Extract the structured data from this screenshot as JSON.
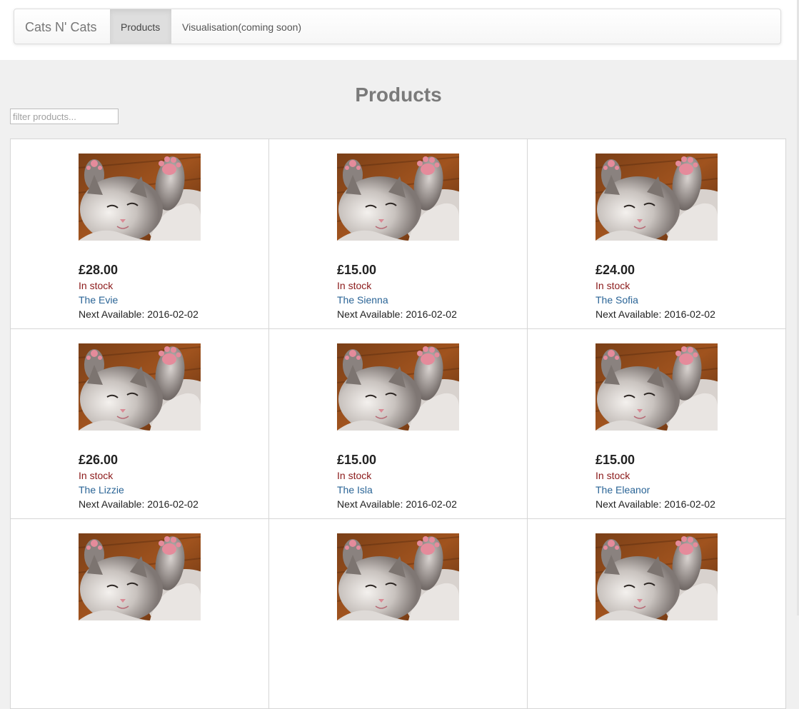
{
  "nav": {
    "brand": "Cats N' Cats",
    "items": [
      {
        "label": "Products",
        "active": true
      },
      {
        "label": "Visualisation(coming soon)",
        "active": false
      }
    ]
  },
  "page": {
    "title": "Products"
  },
  "filter": {
    "placeholder": "filter products...",
    "value": ""
  },
  "products": [
    {
      "price": "£28.00",
      "stock": "In stock",
      "name": "The Evie",
      "next_label": "Next Available:",
      "next_date": "2016-02-02",
      "image": "kitten-photo"
    },
    {
      "price": "£15.00",
      "stock": "In stock",
      "name": "The Sienna",
      "next_label": "Next Available:",
      "next_date": "2016-02-02",
      "image": "kitten-photo"
    },
    {
      "price": "£24.00",
      "stock": "In stock",
      "name": "The Sofia",
      "next_label": "Next Available:",
      "next_date": "2016-02-02",
      "image": "kitten-photo"
    },
    {
      "price": "£26.00",
      "stock": "In stock",
      "name": "The Lizzie",
      "next_label": "Next Available:",
      "next_date": "2016-02-02",
      "image": "kitten-photo"
    },
    {
      "price": "£15.00",
      "stock": "In stock",
      "name": "The Isla",
      "next_label": "Next Available:",
      "next_date": "2016-02-02",
      "image": "kitten-photo"
    },
    {
      "price": "£15.00",
      "stock": "In stock",
      "name": "The Eleanor",
      "next_label": "Next Available:",
      "next_date": "2016-02-02",
      "image": "kitten-photo"
    },
    {
      "price": "",
      "stock": "",
      "name": "",
      "next_label": "",
      "next_date": "",
      "image": "kitten-photo"
    },
    {
      "price": "",
      "stock": "",
      "name": "",
      "next_label": "",
      "next_date": "",
      "image": "kitten-photo"
    },
    {
      "price": "",
      "stock": "",
      "name": "",
      "next_label": "",
      "next_date": "",
      "image": "kitten-photo"
    }
  ],
  "colors": {
    "link": "#2a6496",
    "stock": "#8b1a1a",
    "title": "#7a7a7a",
    "background": "#f0f0f0"
  }
}
